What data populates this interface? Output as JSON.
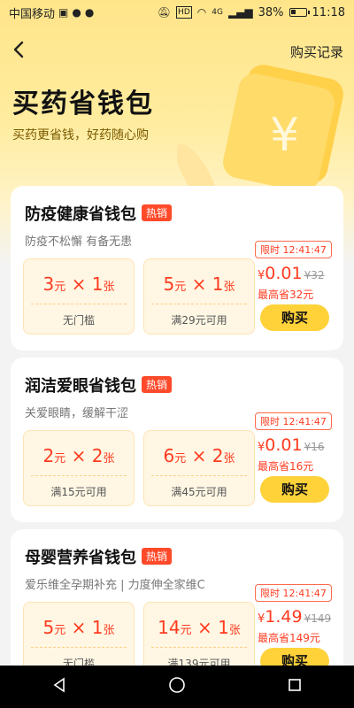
{
  "status": {
    "carrier": "中国移动",
    "battery": "38%",
    "time": "11:18",
    "network": "4G",
    "battery_fraction": 0.38
  },
  "nav": {
    "record": "购买记录"
  },
  "hero": {
    "title": "买药省钱包",
    "subtitle": "买药更省钱，好药随心购",
    "deco_symbol": "¥"
  },
  "cards": [
    {
      "title": "防疫健康省钱包",
      "hot": "热销",
      "desc": "防疫不松懈 有备无患",
      "coupons": [
        {
          "amount": "3",
          "unit": "元",
          "times": "× 1",
          "count_unit": "张",
          "cond": "无门槛"
        },
        {
          "amount": "5",
          "unit": "元",
          "times": "× 1",
          "count_unit": "张",
          "cond": "满29元可用"
        }
      ],
      "timer": "限时 12:41:47",
      "currency": "¥",
      "price": "0.01",
      "orig": "¥32",
      "saving": "最高省32元",
      "buy": "购买"
    },
    {
      "title": "润洁爱眼省钱包",
      "hot": "热销",
      "desc": "关爱眼睛，缓解干涩",
      "coupons": [
        {
          "amount": "2",
          "unit": "元",
          "times": "× 2",
          "count_unit": "张",
          "cond": "满15元可用"
        },
        {
          "amount": "6",
          "unit": "元",
          "times": "× 2",
          "count_unit": "张",
          "cond": "满45元可用"
        }
      ],
      "timer": "限时 12:41:47",
      "currency": "¥",
      "price": "0.01",
      "orig": "¥16",
      "saving": "最高省16元",
      "buy": "购买"
    },
    {
      "title": "母婴营养省钱包",
      "hot": "热销",
      "desc": "爱乐维全孕期补充 | 力度伸全家维C",
      "coupons": [
        {
          "amount": "5",
          "unit": "元",
          "times": "× 1",
          "count_unit": "张",
          "cond": "无门槛"
        },
        {
          "amount": "14",
          "unit": "元",
          "times": "× 1",
          "count_unit": "张",
          "cond": "满139元可用"
        }
      ],
      "timer": "限时 12:41:47",
      "currency": "¥",
      "price": "1.49",
      "orig": "¥149",
      "saving": "最高省149元",
      "buy": "购买"
    }
  ],
  "icons": {
    "back": "back-arrow-icon",
    "nav_back": "triangle-back-icon",
    "nav_home": "circle-home-icon",
    "nav_recent": "square-recent-icon"
  },
  "colors": {
    "accent": "#ff3b1f",
    "button": "#ffd23a",
    "hero": "#ffe58a"
  }
}
